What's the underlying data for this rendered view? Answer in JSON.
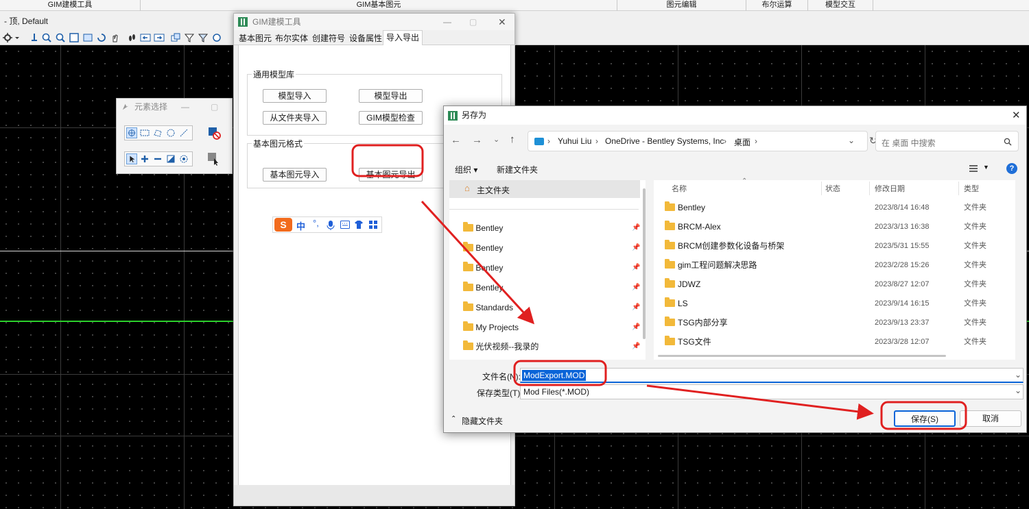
{
  "ribbon": {
    "tabs": [
      "GIM建模工具",
      "GIM基本图元",
      "图元编辑",
      "布尔运算",
      "模型交互"
    ]
  },
  "view": {
    "title": "- 顶, Default"
  },
  "element_select": {
    "title": "元素选择"
  },
  "gim_tool": {
    "title": "GIM建模工具",
    "tabs": [
      "基本图元",
      "布尔实体",
      "创建符号",
      "设备属性",
      "导入导出"
    ],
    "active_tab": "导入导出",
    "group1": {
      "label": "通用模型库",
      "buttons": [
        "模型导入",
        "模型导出",
        "从文件夹导入",
        "GIM模型检查"
      ]
    },
    "group2": {
      "label": "基本图元格式",
      "buttons": [
        "基本图元导入",
        "基本图元导出"
      ]
    },
    "ime_label": "中"
  },
  "save_dialog": {
    "title": "另存为",
    "breadcrumb": [
      "Yuhui Liu",
      "OneDrive - Bentley Systems, Inc",
      "桌面"
    ],
    "search_placeholder": "在 桌面 中搜索",
    "organize": "组织 ▾",
    "new_folder": "新建文件夹",
    "nav": {
      "home": "主文件夹",
      "items": [
        "Bentley",
        "Bentley",
        "Bentley",
        "Bentley",
        "Standards",
        "My Projects",
        "光伏视频--我录的"
      ]
    },
    "columns": {
      "name": "名称",
      "status": "状态",
      "modified": "修改日期",
      "type": "类型"
    },
    "files": [
      {
        "name": "Bentley",
        "date": "2023/8/14 16:48",
        "type": "文件夹"
      },
      {
        "name": "BRCM-Alex",
        "date": "2023/3/13 16:38",
        "type": "文件夹"
      },
      {
        "name": "BRCM创建参数化设备与桥架",
        "date": "2023/5/31 15:55",
        "type": "文件夹"
      },
      {
        "name": "gim工程问题解决思路",
        "date": "2023/2/28 15:26",
        "type": "文件夹"
      },
      {
        "name": "JDWZ",
        "date": "2023/8/27 12:07",
        "type": "文件夹"
      },
      {
        "name": "LS",
        "date": "2023/9/14 16:15",
        "type": "文件夹"
      },
      {
        "name": "TSG内部分享",
        "date": "2023/9/13 23:37",
        "type": "文件夹"
      },
      {
        "name": "TSG文件",
        "date": "2023/3/28 12:07",
        "type": "文件夹"
      }
    ],
    "filename_label": "文件名(N):",
    "filename_value": "ModExport.MOD",
    "filetype_label": "保存类型(T):",
    "filetype_value": "Mod Files(*.MOD)",
    "hide_folders": "隐藏文件夹",
    "save": "保存(S)",
    "cancel": "取消"
  },
  "colors": {
    "annotation": "#e02020",
    "selection": "#0a64d8",
    "grid_green": "#2bd02b"
  }
}
